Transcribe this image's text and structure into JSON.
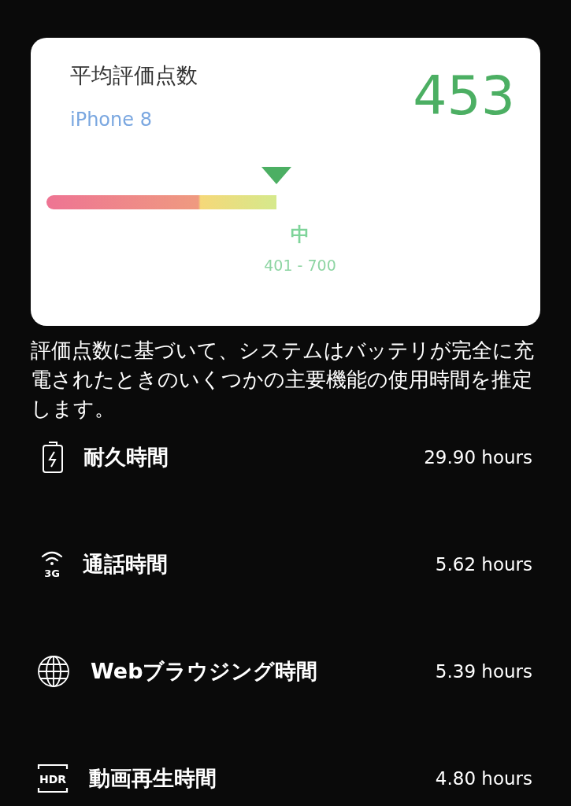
{
  "score_card": {
    "title": "平均評価点数",
    "device": "iPhone 8",
    "score": "453",
    "grade": "中",
    "range": "401 - 700"
  },
  "description": "評価点数に基づいて、システムはバッテリが完全に充電されたときのいくつかの主要機能の使用時間を推定します。",
  "metrics": [
    {
      "kind": "battery",
      "label": "耐久時間",
      "value": "29.90 hours"
    },
    {
      "kind": "signal",
      "icon_text": "3G",
      "label": "通話時間",
      "value": "5.62 hours"
    },
    {
      "kind": "globe",
      "label": "Webブラウジング時間",
      "value": "5.39 hours"
    },
    {
      "kind": "badge",
      "icon_text": "HDR",
      "label": "動画再生時間",
      "value": "4.80 hours"
    }
  ]
}
